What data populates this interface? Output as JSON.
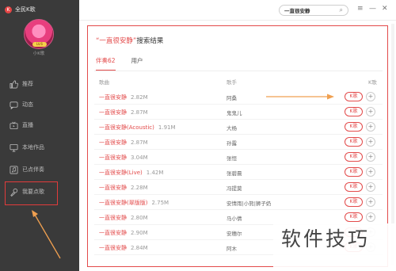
{
  "app": {
    "logo_glyph": "K",
    "title": "全民K歌"
  },
  "user": {
    "badge": "LV.6",
    "name": "小K歌"
  },
  "nav": [
    {
      "label": "推荐",
      "icon": "thumbs-up-icon"
    },
    {
      "label": "动态",
      "icon": "chat-icon"
    },
    {
      "label": "直播",
      "icon": "tv-icon"
    },
    {
      "label": "本地作品",
      "icon": "monitor-icon"
    },
    {
      "label": "已点伴奏",
      "icon": "music-note-icon"
    },
    {
      "label": "我要点歌",
      "icon": "microphone-icon"
    }
  ],
  "search": {
    "value": "一直很安静",
    "icon_glyph": "⌕"
  },
  "window": {
    "menu": "≡",
    "minimize": "—",
    "close": "✕"
  },
  "results": {
    "keyword": "“一直很安静”",
    "suffix": "搜索结果",
    "tabs": [
      {
        "label": "伴奏62"
      },
      {
        "label": "用户"
      }
    ],
    "columns": {
      "song": "歌曲",
      "singer": "歌手",
      "k": "K歌"
    },
    "k_button": "K歌",
    "add_button": "+",
    "rows": [
      {
        "song": "一直很安静",
        "size": "2.82M",
        "singer": "阿桑"
      },
      {
        "song": "一直很安静",
        "size": "2.87M",
        "singer": "鬼鬼儿"
      },
      {
        "song": "一直很安静(Acoustic)",
        "size": "1.91M",
        "singer": "大杨"
      },
      {
        "song": "一直很安静",
        "size": "2.87M",
        "singer": "孙露"
      },
      {
        "song": "一直很安静",
        "size": "3.04M",
        "singer": "张恒"
      },
      {
        "song": "一直很安静(Live)",
        "size": "1.42M",
        "singer": "张碧晨"
      },
      {
        "song": "一直很安静",
        "size": "2.28M",
        "singer": "冯提莫"
      },
      {
        "song": "一直很安静(翠版版)",
        "size": "2.75M",
        "singer": "安情雨|小熊|狮子奶"
      },
      {
        "song": "一直很安静",
        "size": "2.80M",
        "singer": "马小倩"
      },
      {
        "song": "一直很安静",
        "size": "2.90M",
        "singer": "安穗尔"
      },
      {
        "song": "一直很安静",
        "size": "2.84M",
        "singer": "阿木"
      }
    ]
  },
  "watermark": "软件技巧",
  "colors": {
    "sidebar": "#3a3a3a",
    "accent": "#e34a4a",
    "arrow": "#f0a050"
  }
}
